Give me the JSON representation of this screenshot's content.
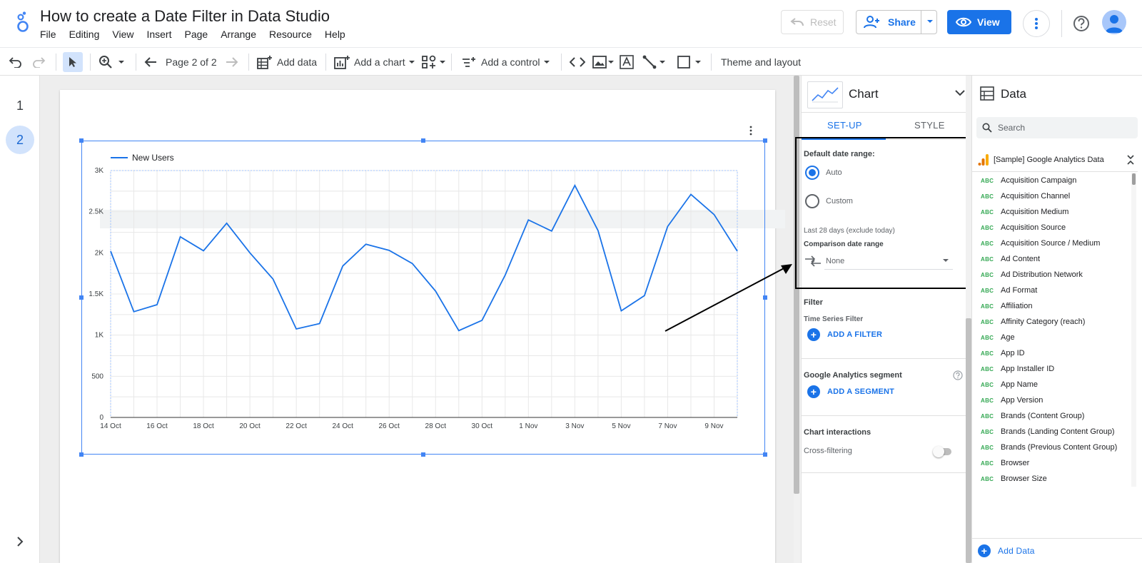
{
  "header": {
    "title": "How to create a Date Filter in Data Studio",
    "menus": [
      "File",
      "Editing",
      "View",
      "Insert",
      "Page",
      "Arrange",
      "Resource",
      "Help"
    ],
    "reset_label": "Reset",
    "share_label": "Share",
    "view_label": "View"
  },
  "toolbar": {
    "page_indicator": "Page 2 of 2",
    "add_data": "Add data",
    "add_chart": "Add a chart",
    "add_control": "Add a control",
    "theme_layout": "Theme and layout"
  },
  "pagenav": {
    "pages": [
      "1",
      "2"
    ],
    "active_page": "2"
  },
  "chart_data": {
    "type": "line",
    "series": [
      {
        "name": "New Users",
        "color": "#1a73e8",
        "values": [
          2020,
          1285,
          1370,
          2195,
          2025,
          2360,
          2000,
          1680,
          1075,
          1140,
          1840,
          2105,
          2030,
          1870,
          1535,
          1055,
          1180,
          1730,
          2400,
          2265,
          2820,
          2270,
          1295,
          1480,
          2320,
          2710,
          2465,
          2020
        ]
      }
    ],
    "x_tick_labels": [
      "14 Oct",
      "16 Oct",
      "18 Oct",
      "20 Oct",
      "22 Oct",
      "24 Oct",
      "26 Oct",
      "28 Oct",
      "30 Oct",
      "1 Nov",
      "3 Nov",
      "5 Nov",
      "7 Nov",
      "9 Nov"
    ],
    "y_tick_labels": [
      "0",
      "500",
      "1K",
      "1.5K",
      "2K",
      "2.5K",
      "3K"
    ],
    "ylim": [
      0,
      3000
    ],
    "grid": true,
    "legend": "top-left"
  },
  "props": {
    "title": "Chart",
    "tab_setup": "SET-UP",
    "tab_style": "STYLE",
    "default_date_range": "Default date range:",
    "auto": "Auto",
    "custom": "Custom",
    "last_28": "Last 28 days (exclude today)",
    "comparison_label": "Comparison date range",
    "comparison_value": "None",
    "filter_title": "Filter",
    "ts_filter": "Time Series Filter",
    "add_filter": "ADD A FILTER",
    "ga_segment": "Google Analytics segment",
    "add_segment": "ADD A SEGMENT",
    "chart_interactions": "Chart interactions",
    "cross_filtering": "Cross-filtering"
  },
  "data": {
    "title": "Data",
    "search_placeholder": "Search",
    "source_name": "[Sample] Google Analytics Data",
    "field_type_label": "ABC",
    "fields": [
      "Acquisition Campaign",
      "Acquisition Channel",
      "Acquisition Medium",
      "Acquisition Source",
      "Acquisition Source / Medium",
      "Ad Content",
      "Ad Distribution Network",
      "Ad Format",
      "Affiliation",
      "Affinity Category (reach)",
      "Age",
      "App ID",
      "App Installer ID",
      "App Name",
      "App Version",
      "Brands (Content Group)",
      "Brands (Landing Content Group)",
      "Brands (Previous Content Group)",
      "Browser",
      "Browser Size"
    ],
    "add_data": "Add Data"
  }
}
